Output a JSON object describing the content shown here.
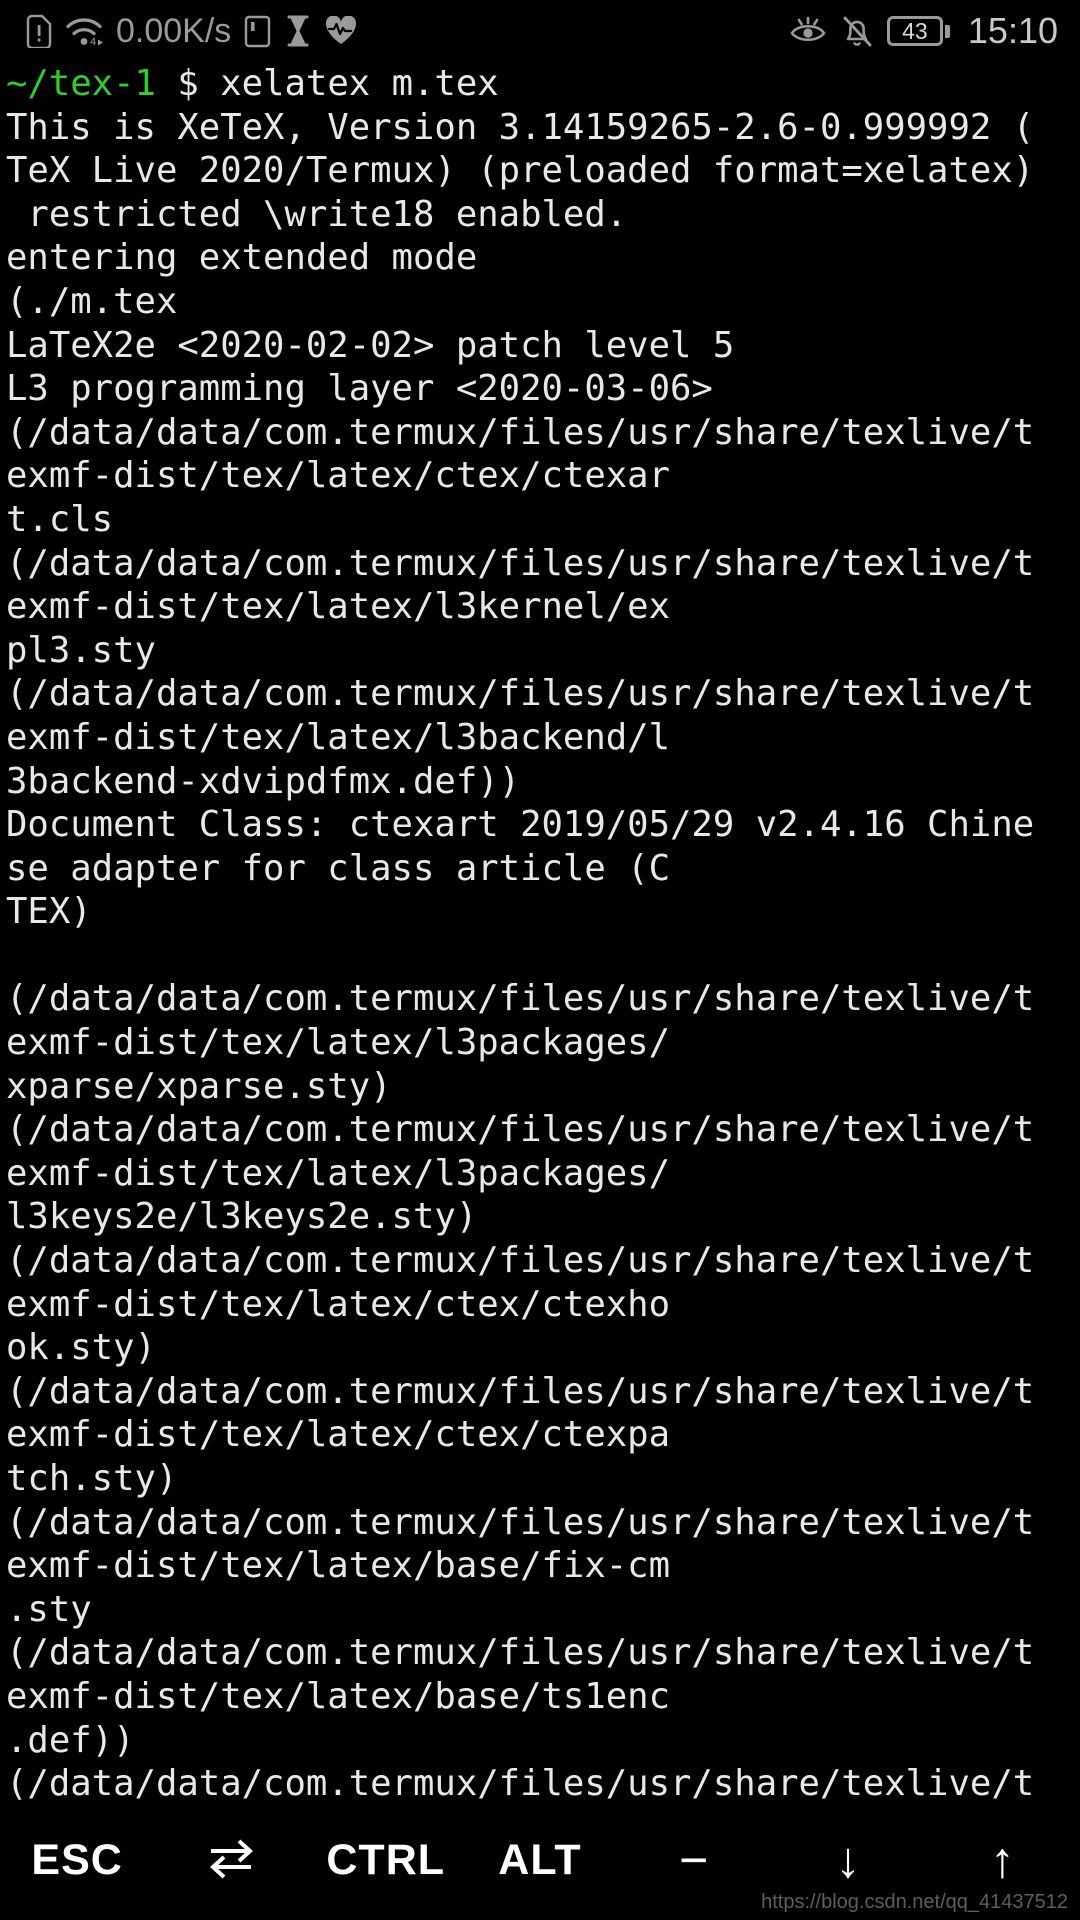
{
  "status_bar": {
    "icons_left": [
      "sim-card-alert-icon",
      "wifi-icon",
      "network-speed-label",
      "sd-card-icon",
      "hourglass-icon",
      "heart-rate-icon"
    ],
    "network_speed": "0.00K/s",
    "icons_right": [
      "eye-comfort-icon",
      "notifications-off-icon",
      "battery-icon"
    ],
    "battery_level": "43",
    "clock": "15:10",
    "colors": {
      "icon": "#9a9a9a",
      "text": "#9a9a9a",
      "clock": "#c9c9c9"
    }
  },
  "terminal": {
    "colors": {
      "background": "#000000",
      "foreground": "#e8e8e8",
      "prompt_green": "#2fce2f"
    },
    "prompt": {
      "path": "~/tex-1",
      "symbol": "$",
      "command": "xelatex m.tex"
    },
    "lines": [
      "This is XeTeX, Version 3.14159265-2.6-0.999992 (",
      "TeX Live 2020/Termux) (preloaded format=xelatex)",
      " restricted \\write18 enabled.",
      "entering extended mode",
      "(./m.tex",
      "LaTeX2e <2020-02-02> patch level 5",
      "L3 programming layer <2020-03-06>",
      "(/data/data/com.termux/files/usr/share/texlive/t",
      "exmf-dist/tex/latex/ctex/ctexar",
      "t.cls",
      "(/data/data/com.termux/files/usr/share/texlive/t",
      "exmf-dist/tex/latex/l3kernel/ex",
      "pl3.sty",
      "(/data/data/com.termux/files/usr/share/texlive/t",
      "exmf-dist/tex/latex/l3backend/l",
      "3backend-xdvipdfmx.def))",
      "Document Class: ctexart 2019/05/29 v2.4.16 Chine",
      "se adapter for class article (C",
      "TEX)",
      "",
      "(/data/data/com.termux/files/usr/share/texlive/t",
      "exmf-dist/tex/latex/l3packages/",
      "xparse/xparse.sty)",
      "(/data/data/com.termux/files/usr/share/texlive/t",
      "exmf-dist/tex/latex/l3packages/",
      "l3keys2e/l3keys2e.sty)",
      "(/data/data/com.termux/files/usr/share/texlive/t",
      "exmf-dist/tex/latex/ctex/ctexho",
      "ok.sty)",
      "(/data/data/com.termux/files/usr/share/texlive/t",
      "exmf-dist/tex/latex/ctex/ctexpa",
      "tch.sty)",
      "(/data/data/com.termux/files/usr/share/texlive/t",
      "exmf-dist/tex/latex/base/fix-cm",
      ".sty",
      "(/data/data/com.termux/files/usr/share/texlive/t",
      "exmf-dist/tex/latex/base/ts1enc",
      ".def))",
      "(/data/data/com.termux/files/usr/share/texlive/t"
    ]
  },
  "key_row": {
    "keys": [
      {
        "label": "ESC",
        "icon": "esc-key"
      },
      {
        "label": "",
        "icon": "tab-key-icon"
      },
      {
        "label": "CTRL",
        "icon": "ctrl-key"
      },
      {
        "label": "ALT",
        "icon": "alt-key"
      },
      {
        "label": "−",
        "icon": "minus-key"
      },
      {
        "label": "↓",
        "icon": "arrow-down-icon"
      },
      {
        "label": "↑",
        "icon": "arrow-up-icon"
      }
    ]
  },
  "watermark": "https://blog.csdn.net/qq_41437512"
}
